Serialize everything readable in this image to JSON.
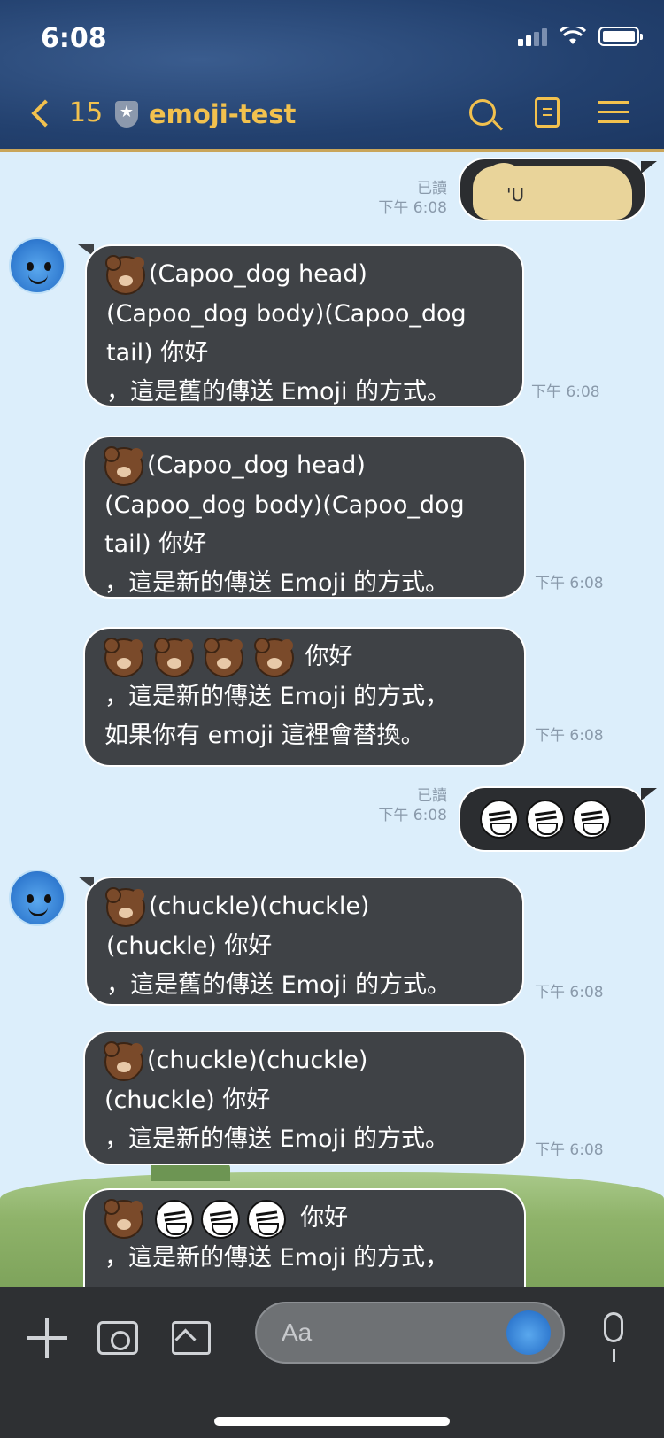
{
  "status": {
    "time": "6:08"
  },
  "header": {
    "back_count": "15",
    "title": "emoji-test"
  },
  "messages": {
    "m1": {
      "read": "已讀",
      "time": "下午 6:08"
    },
    "m2": {
      "lines": [
        "(Capoo_dog head)",
        "(Capoo_dog body)(Capoo_dog",
        "tail) 你好",
        "，這是舊的傳送 Emoji 的方式。"
      ],
      "time": "下午 6:08"
    },
    "m3": {
      "lines": [
        "(Capoo_dog head)",
        "(Capoo_dog body)(Capoo_dog",
        "tail) 你好",
        "，這是新的傳送 Emoji 的方式。"
      ],
      "time": "下午 6:08"
    },
    "m4": {
      "lines": [
        "你好",
        "，這是新的傳送 Emoji 的方式，",
        "如果你有 emoji 這裡會替換。"
      ],
      "time": "下午 6:08"
    },
    "m5": {
      "read": "已讀",
      "time": "下午 6:08"
    },
    "m6": {
      "lines": [
        "(chuckle)(chuckle)",
        "(chuckle) 你好",
        "，這是舊的傳送 Emoji 的方式。"
      ],
      "time": "下午 6:08"
    },
    "m7": {
      "lines": [
        "(chuckle)(chuckle)",
        "(chuckle) 你好",
        "，這是新的傳送 Emoji 的方式。"
      ],
      "time": "下午 6:08"
    },
    "m8": {
      "lines": [
        "你好",
        "，這是新的傳送 Emoji 的方式，"
      ]
    }
  },
  "input": {
    "placeholder": "Aa"
  }
}
